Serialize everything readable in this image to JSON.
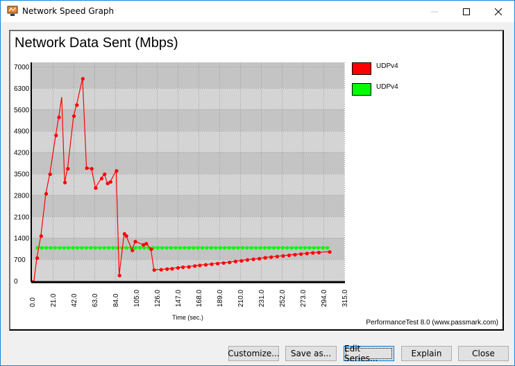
{
  "window": {
    "title": "Network Speed Graph",
    "controls": {
      "minimize": "minimize",
      "maximize": "maximize",
      "close": "close"
    }
  },
  "buttons": {
    "customize": "Customize...",
    "save_as": "Save as...",
    "edit_series": "Edit Series...",
    "explain": "Explain",
    "close": "Close"
  },
  "credit": "PerformanceTest 8.0 (www.passmark.com)",
  "chart_data": {
    "type": "line",
    "title": "Network Data Sent (Mbps)",
    "xlabel": "Time (sec.)",
    "ylabel": "",
    "xlim": [
      0,
      315
    ],
    "ylim": [
      0,
      7000
    ],
    "xticks": [
      "0.0",
      "21.0",
      "42.0",
      "63.0",
      "84.0",
      "105.0",
      "126.0",
      "147.0",
      "168.0",
      "189.0",
      "210.0",
      "231.0",
      "252.0",
      "273.0",
      "294.0",
      "315.0"
    ],
    "yticks": [
      "0",
      "700",
      "1400",
      "2100",
      "2800",
      "3500",
      "4200",
      "4900",
      "5600",
      "6300",
      "7000"
    ],
    "grid": true,
    "legend": "right",
    "series": [
      {
        "name": "UDPv4",
        "color": "#ff0000",
        "points": [
          [
            2,
            0
          ],
          [
            5,
            750
          ],
          [
            9,
            1470
          ],
          [
            14,
            2850
          ],
          [
            18,
            3490
          ],
          [
            24,
            4760
          ],
          [
            27,
            5350
          ],
          [
            30,
            6000
          ],
          [
            33,
            3220
          ],
          [
            36,
            3670
          ],
          [
            42,
            5390
          ],
          [
            45,
            5750
          ],
          [
            51,
            6610
          ],
          [
            55,
            3690
          ],
          [
            60,
            3670
          ],
          [
            64,
            3040
          ],
          [
            70,
            3350
          ],
          [
            73,
            3490
          ],
          [
            76,
            3190
          ],
          [
            79,
            3240
          ],
          [
            85,
            3600
          ],
          [
            88,
            180
          ],
          [
            93,
            1540
          ],
          [
            95,
            1470
          ],
          [
            101,
            1000
          ],
          [
            104,
            1290
          ],
          [
            112,
            1180
          ],
          [
            115,
            1220
          ],
          [
            120,
            1040
          ],
          [
            123,
            360
          ],
          [
            130,
            370
          ],
          [
            136,
            390
          ],
          [
            141,
            400
          ],
          [
            147,
            430
          ],
          [
            152,
            450
          ],
          [
            158,
            460
          ],
          [
            164,
            490
          ],
          [
            169,
            510
          ],
          [
            175,
            530
          ],
          [
            181,
            550
          ],
          [
            187,
            570
          ],
          [
            193,
            590
          ],
          [
            199,
            610
          ],
          [
            205,
            640
          ],
          [
            211,
            660
          ],
          [
            217,
            690
          ],
          [
            223,
            710
          ],
          [
            229,
            730
          ],
          [
            235,
            760
          ],
          [
            241,
            780
          ],
          [
            247,
            800
          ],
          [
            253,
            820
          ],
          [
            259,
            840
          ],
          [
            265,
            860
          ],
          [
            271,
            880
          ],
          [
            277,
            900
          ],
          [
            283,
            920
          ],
          [
            289,
            930
          ],
          [
            300,
            950
          ]
        ]
      },
      {
        "name": "UDPv4",
        "color": "#00ff00",
        "points": [
          [
            5,
            1085
          ],
          [
            300,
            1085
          ]
        ],
        "marker_interval_sec": 4.5
      }
    ]
  }
}
